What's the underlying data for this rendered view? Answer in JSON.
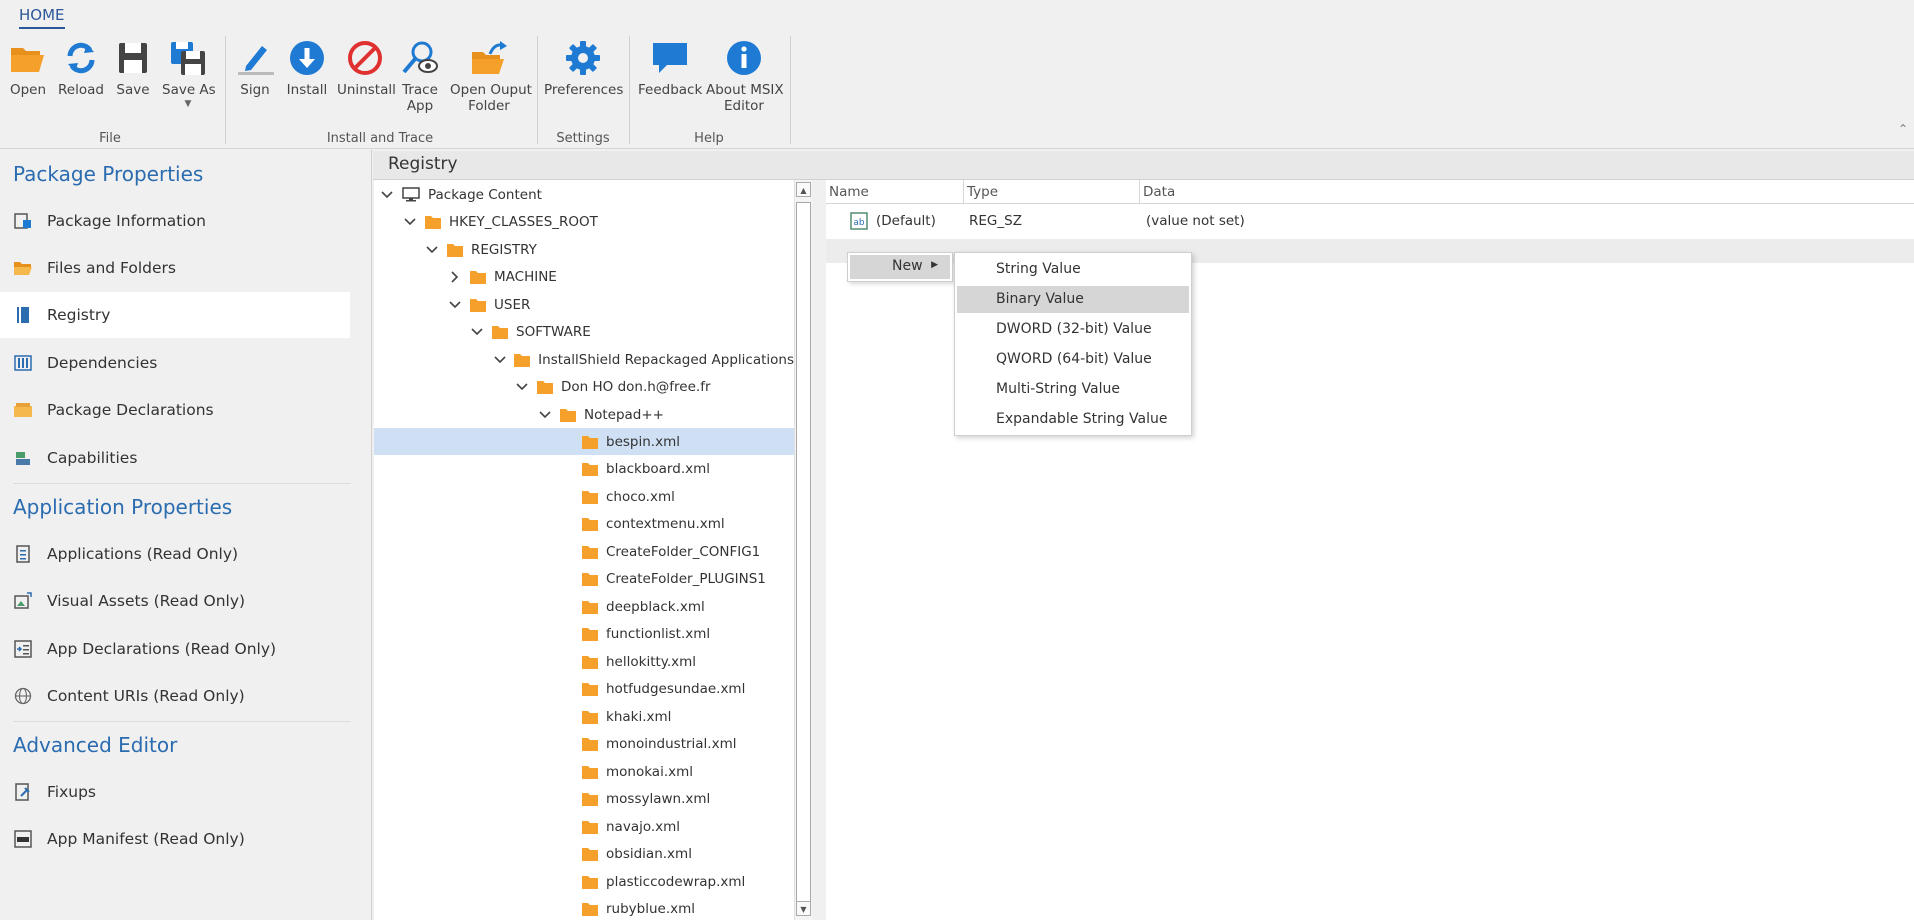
{
  "ribbon": {
    "tab": "HOME",
    "buttons": {
      "open": "Open",
      "reload": "Reload",
      "save": "Save",
      "save_as": "Save As",
      "sign": "Sign",
      "install": "Install",
      "uninstall": "Uninstall",
      "trace_app_1": "Trace",
      "trace_app_2": "App",
      "open_output_1": "Open Ouput",
      "open_output_2": "Folder",
      "preferences": "Preferences",
      "feedback": "Feedback",
      "about_1": "About MSIX",
      "about_2": "Editor"
    },
    "groups": {
      "file": "File",
      "install_trace": "Install and Trace",
      "settings": "Settings",
      "help": "Help"
    },
    "colors": {
      "accent": "#2b579a",
      "folder": "#f5a02a",
      "blue_icon": "#1f7ad3",
      "red_icon": "#e03131"
    }
  },
  "leftnav": {
    "sections": {
      "package": "Package Properties",
      "application": "Application Properties",
      "advanced": "Advanced Editor"
    },
    "items": {
      "package_information": "Package Information",
      "files_and_folders": "Files and Folders",
      "registry": "Registry",
      "dependencies": "Dependencies",
      "package_declarations": "Package Declarations",
      "capabilities": "Capabilities",
      "applications": "Applications (Read Only)",
      "visual_assets": "Visual Assets (Read Only)",
      "app_declarations": "App Declarations (Read Only)",
      "content_uris": "Content URIs (Read Only)",
      "fixups": "Fixups",
      "app_manifest": "App Manifest (Read Only)"
    },
    "active": "Registry"
  },
  "main": {
    "title": "Registry",
    "tree": {
      "root": "Package Content",
      "hkcr": "HKEY_CLASSES_ROOT",
      "registry": "REGISTRY",
      "machine": "MACHINE",
      "user": "USER",
      "software": "SOFTWARE",
      "installshield": "InstallShield Repackaged Applications",
      "donho": "Don HO don.h@free.fr",
      "notepad": "Notepad++",
      "files": [
        "bespin.xml",
        "blackboard.xml",
        "choco.xml",
        "contextmenu.xml",
        "CreateFolder_CONFIG1",
        "CreateFolder_PLUGINS1",
        "deepblack.xml",
        "functionlist.xml",
        "hellokitty.xml",
        "hotfudgesundae.xml",
        "khaki.xml",
        "monoindustrial.xml",
        "monokai.xml",
        "mossylawn.xml",
        "navajo.xml",
        "obsidian.xml",
        "plasticcodewrap.xml",
        "rubyblue.xml"
      ],
      "selected": "bespin.xml"
    },
    "values": {
      "columns": {
        "name": "Name",
        "type": "Type",
        "data": "Data"
      },
      "row": {
        "icon": "ab",
        "name": "(Default)",
        "type": "REG_SZ",
        "data": "(value not set)"
      }
    },
    "context_menu": {
      "new": "New",
      "submenu": [
        "String Value",
        "Binary Value",
        "DWORD (32-bit) Value",
        "QWORD (64-bit) Value",
        "Multi-String Value",
        "Expandable String Value"
      ],
      "hovered": "Binary Value"
    }
  }
}
